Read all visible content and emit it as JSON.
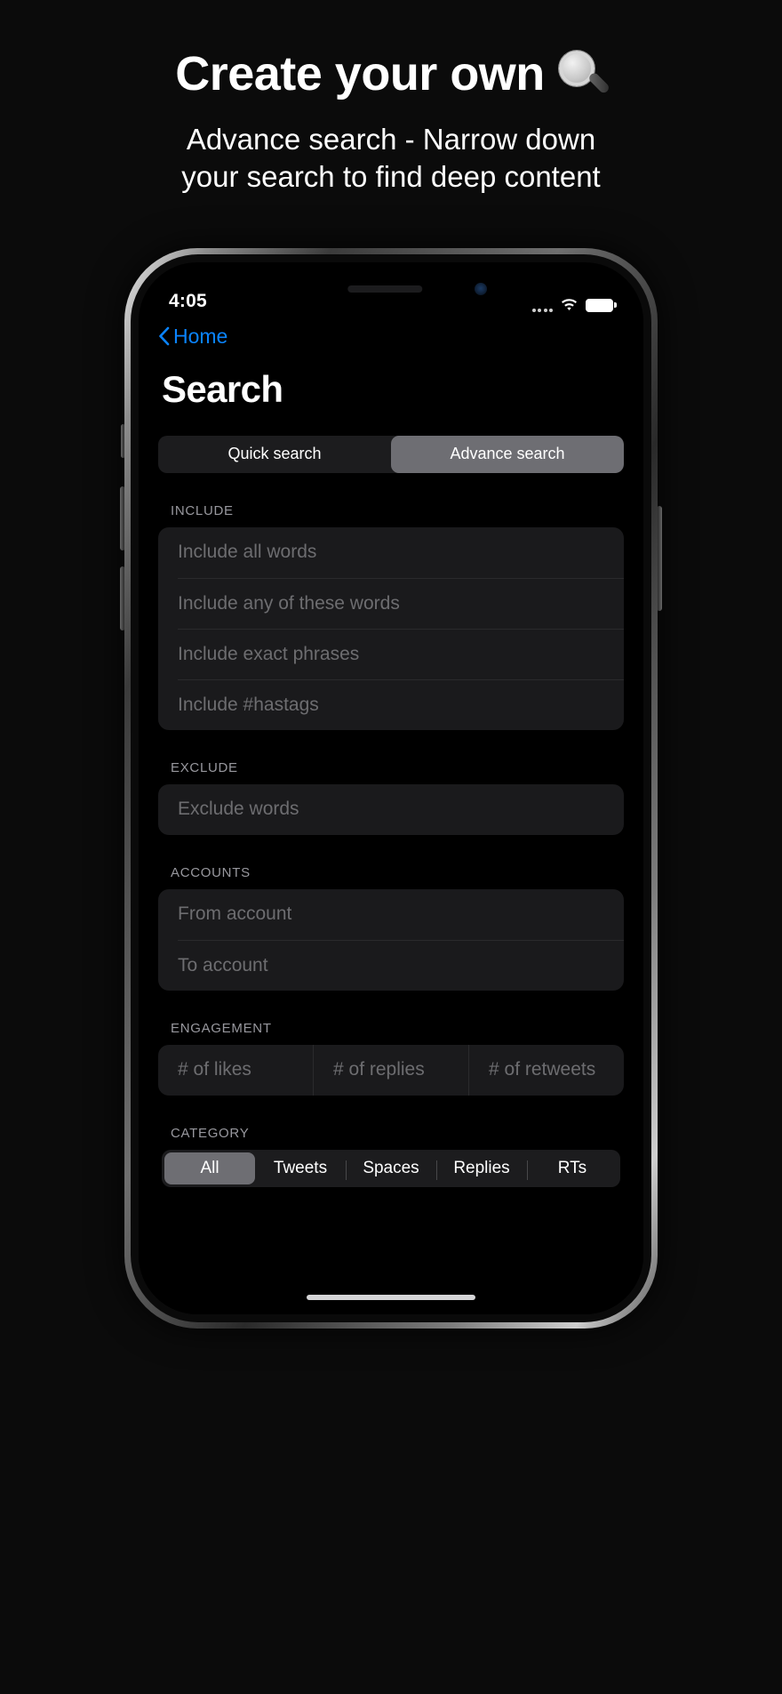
{
  "promo": {
    "title": "Create your own",
    "title_emoji": "magnifying-glass",
    "subtitle_line1": "Advance search - Narrow down",
    "subtitle_line2": "your search to find deep content"
  },
  "colors": {
    "background": "#0b0b0b",
    "screen_background": "#000000",
    "accent_blue": "#0a84ff",
    "field_background": "#1a1a1c",
    "segmented_background": "#1c1c1e",
    "segmented_selected": "#6e6e73",
    "placeholder_text": "#6d6d70",
    "section_label": "#98989e"
  },
  "status_bar": {
    "time": "4:05",
    "cellular_icon": "signal-dots-icon",
    "wifi_icon": "wifi-icon",
    "battery_icon": "battery-full-icon"
  },
  "nav": {
    "back_icon": "chevron-left-icon",
    "back_label": "Home"
  },
  "screen": {
    "title": "Search"
  },
  "search_mode_tabs": [
    {
      "label": "Quick search",
      "selected": false
    },
    {
      "label": "Advance search",
      "selected": true
    }
  ],
  "sections": [
    {
      "label": "INCLUDE",
      "type": "stacked",
      "fields": [
        {
          "placeholder": "Include all words",
          "value": ""
        },
        {
          "placeholder": "Include any of these words",
          "value": ""
        },
        {
          "placeholder": "Include exact phrases",
          "value": ""
        },
        {
          "placeholder": "Include #hastags",
          "value": ""
        }
      ]
    },
    {
      "label": "EXCLUDE",
      "type": "stacked",
      "fields": [
        {
          "placeholder": "Exclude words",
          "value": ""
        }
      ]
    },
    {
      "label": "ACCOUNTS",
      "type": "stacked",
      "fields": [
        {
          "placeholder": "From account",
          "value": ""
        },
        {
          "placeholder": "To account",
          "value": ""
        }
      ]
    },
    {
      "label": "ENGAGEMENT",
      "type": "row",
      "fields": [
        {
          "placeholder": "# of likes",
          "value": ""
        },
        {
          "placeholder": "# of replies",
          "value": ""
        },
        {
          "placeholder": "# of retweets",
          "value": ""
        }
      ]
    },
    {
      "label": "CATEGORY",
      "type": "segmented",
      "options": [
        {
          "label": "All",
          "selected": true
        },
        {
          "label": "Tweets",
          "selected": false
        },
        {
          "label": "Spaces",
          "selected": false
        },
        {
          "label": "Replies",
          "selected": false
        },
        {
          "label": "RTs",
          "selected": false
        }
      ]
    }
  ]
}
